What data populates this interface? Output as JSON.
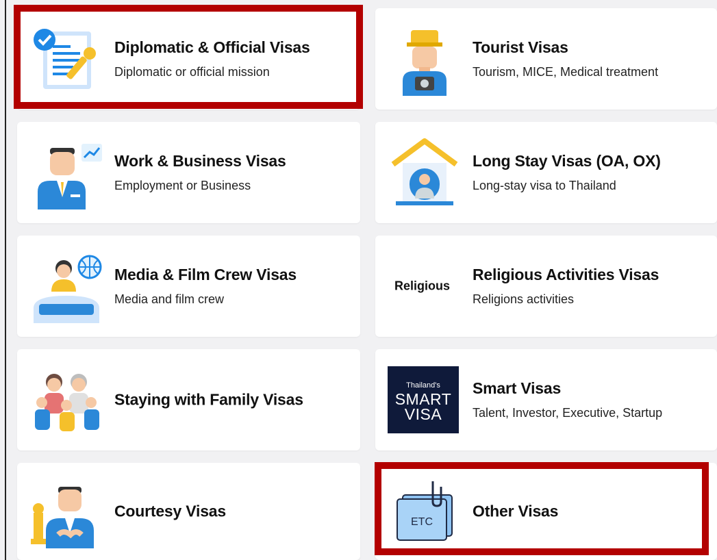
{
  "cards": [
    {
      "title": "Diplomatic & Official Visas",
      "subtitle": "Diplomatic or official mission",
      "icon": "document-check-icon"
    },
    {
      "title": "Tourist Visas",
      "subtitle": "Tourism, MICE, Medical treatment",
      "icon": "tourist-icon"
    },
    {
      "title": "Work & Business Visas",
      "subtitle": "Employment or Business",
      "icon": "businessman-icon"
    },
    {
      "title": "Long Stay Visas (OA, OX)",
      "subtitle": "Long-stay visa to Thailand",
      "icon": "house-person-icon"
    },
    {
      "title": "Media & Film Crew Visas",
      "subtitle": "Media and film crew",
      "icon": "news-reporter-icon"
    },
    {
      "title": "Religious Activities Visas",
      "subtitle": "Religions activities",
      "icon_text": "Religious"
    },
    {
      "title": "Staying with Family Visas",
      "subtitle": "",
      "icon": "family-icon"
    },
    {
      "title": "Smart Visas",
      "subtitle": "Talent, Investor, Executive, Startup",
      "logo": {
        "line1": "Thailand's",
        "line2": "SMART",
        "line3": "VISA"
      }
    },
    {
      "title": "Courtesy Visas",
      "subtitle": "",
      "icon": "courtesy-icon"
    },
    {
      "title": "Other Visas",
      "subtitle": "",
      "icon_text": "ETC"
    }
  ],
  "colors": {
    "highlight": "#b30000",
    "accent_blue": "#1e88e5",
    "accent_yellow": "#f5c02b",
    "smart_bg": "#0f1a3a"
  }
}
